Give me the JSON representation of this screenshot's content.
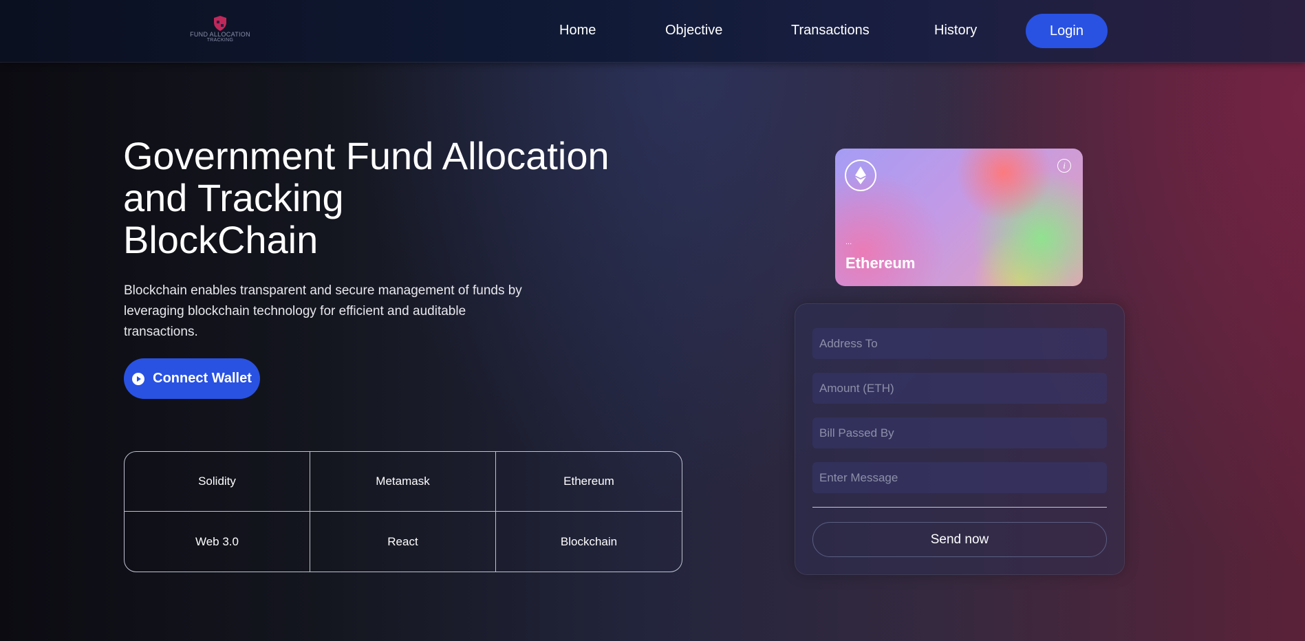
{
  "nav": {
    "logo_text_1": "FUND ALLOCATION",
    "logo_text_2": "TRACKING",
    "links": [
      "Home",
      "Objective",
      "Transactions",
      "History"
    ],
    "login_label": "Login"
  },
  "hero": {
    "title_lines": [
      "Government Fund Allocation",
      "and Tracking",
      "BlockChain"
    ],
    "description": "Blockchain enables transparent and secure management of funds by leveraging blockchain technology for efficient and auditable transactions.",
    "connect_label": "Connect Wallet"
  },
  "tech": [
    "Solidity",
    "Metamask",
    "Ethereum",
    "Web 3.0",
    "React",
    "Blockchain"
  ],
  "card": {
    "address": "...",
    "name": "Ethereum",
    "info_glyph": "i"
  },
  "form": {
    "address_placeholder": "Address To",
    "amount_placeholder": "Amount (ETH)",
    "bill_placeholder": "Bill Passed By",
    "message_placeholder": "Enter Message",
    "send_label": "Send now"
  },
  "colors": {
    "accent": "#2952e3",
    "logo": "#c0285a"
  }
}
